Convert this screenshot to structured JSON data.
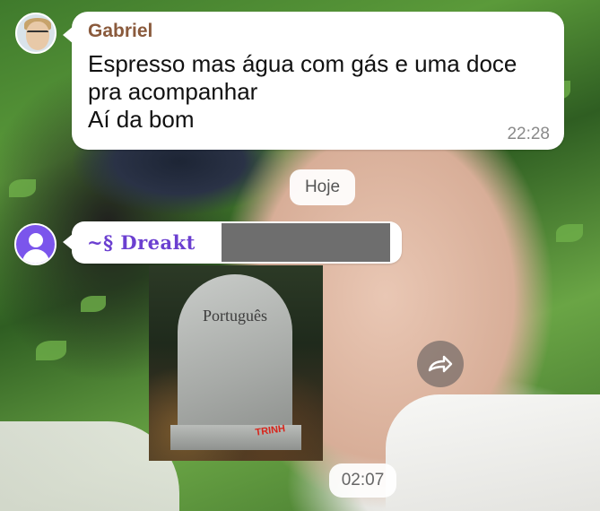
{
  "messages": [
    {
      "sender": "Gabriel",
      "text": "Espresso mas água com gás e uma doce\npra acompanhar\nAí da bom",
      "time": "22:28"
    }
  ],
  "date_separator": "Hoje",
  "second_message": {
    "sender": "~§ Dreakt",
    "image_text": "Português",
    "watermark": "TRINH",
    "time": "02:07"
  },
  "icons": {
    "share": "share-forward-icon",
    "default_avatar": "user-avatar-icon"
  },
  "colors": {
    "sender_1": "#8a5a3c",
    "sender_2": "#6b3fd0",
    "avatar_bg": "#7b55ec"
  }
}
